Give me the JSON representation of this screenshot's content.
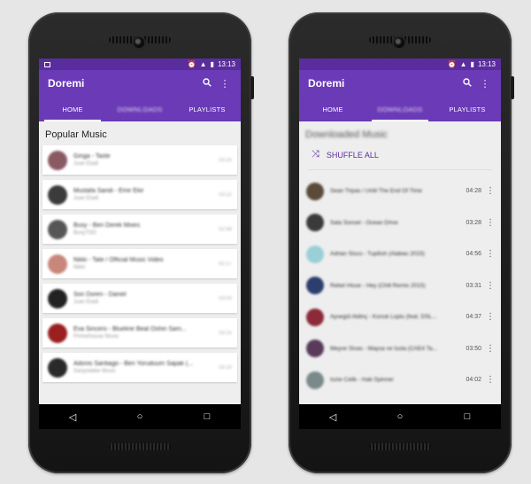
{
  "status": {
    "time": "13:13"
  },
  "app": {
    "title": "Doremi"
  },
  "tabs": [
    {
      "label": "HOME"
    },
    {
      "label": "DOWNLOADS"
    },
    {
      "label": "PLAYLISTS"
    }
  ],
  "home": {
    "section_title": "Popular Music",
    "items": [
      {
        "title": "Ginga - Taste",
        "subtitle": "Juan Eladi",
        "time": "03:25",
        "color": "#8a5a63"
      },
      {
        "title": "Mustafa Sandi - Emir Ekir",
        "subtitle": "Juan Eladi",
        "time": "03:22",
        "color": "#3b3b3b"
      },
      {
        "title": "Busy - Ben Derek Mixes",
        "subtitle": "BusyTDD",
        "time": "02:58",
        "color": "#565656"
      },
      {
        "title": "Nikki - Tate / Official Music Video",
        "subtitle": "Nikki",
        "time": "02:17",
        "color": "#c8877a"
      },
      {
        "title": "Son Doren - Daniel",
        "subtitle": "Juan Eladi",
        "time": "03:03",
        "color": "#222222"
      },
      {
        "title": "Eva Sincero - Blueline Beat Oshin Sam...",
        "subtitle": "Primerhouse Music",
        "time": "03:15",
        "color": "#9a2020"
      },
      {
        "title": "Adonis Santiago - Ben Yoruduum Sapak (...",
        "subtitle": "Sanyodebe Music",
        "time": "03:10",
        "color": "#2a2a2a"
      }
    ]
  },
  "downloads": {
    "section_title": "Downloaded Music",
    "shuffle_label": "SHUFFLE ALL",
    "items": [
      {
        "title": "Sean Tripas / Until The End Of Time",
        "duration": "04:28",
        "color": "#5a4a3a"
      },
      {
        "title": "Sala Sonsel - Ocean Drive",
        "duration": "03:28",
        "color": "#3a3a3a"
      },
      {
        "title": "Adrian Sisco - Tupilish (Alabao 2015)",
        "duration": "04:56",
        "color": "#9acfd8"
      },
      {
        "title": "Rebel Hisse - Hey (Chill Remix 2015)",
        "duration": "03:31",
        "color": "#2c3e6e"
      },
      {
        "title": "Aysegül Aldinç - Konuk Loplu (feat. DSL...",
        "duration": "04:37",
        "color": "#8c2a3a"
      },
      {
        "title": "Meyve Sivas - Maysa ve Isola (CAE4 Ta...",
        "duration": "03:50",
        "color": "#5a3a5a"
      },
      {
        "title": "Iozie Celik - Hab Spinner",
        "duration": "04:02",
        "color": "#7a8a8a"
      }
    ]
  },
  "nav": {
    "back": "◁",
    "home": "○",
    "recents": "□"
  }
}
